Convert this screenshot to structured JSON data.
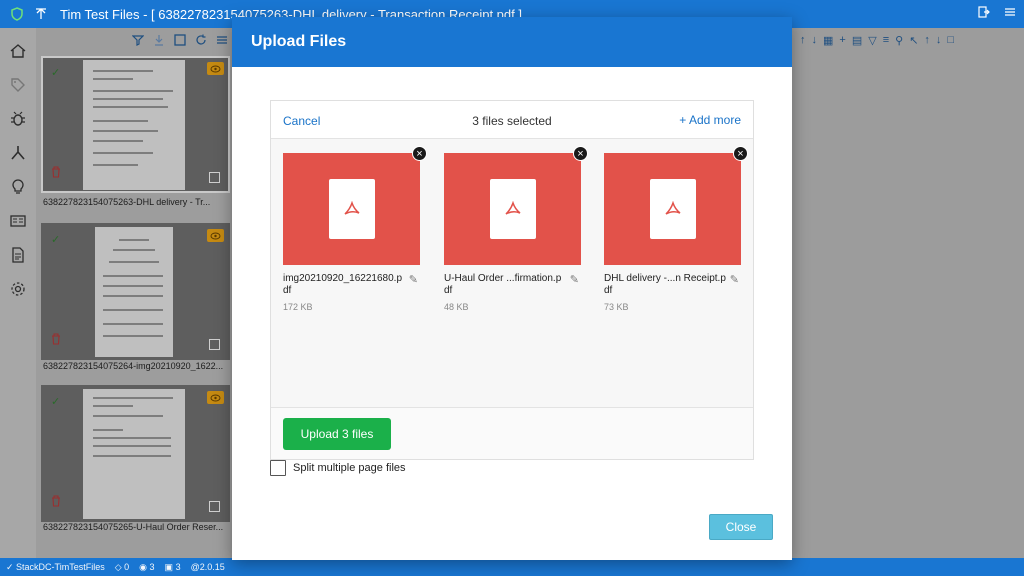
{
  "app": {
    "title": "Tim Test Files - [ 638227823154075263-DHL delivery - Transaction Receipt.pdf ]",
    "logo_icon": "shield-check-icon",
    "up_icon": "arrow-up-icon"
  },
  "sidebar": {
    "items": [
      {
        "name": "home-icon"
      },
      {
        "name": "tag-icon"
      },
      {
        "name": "bug-icon"
      },
      {
        "name": "merge-icon"
      },
      {
        "name": "lightbulb-icon"
      },
      {
        "name": "id-card-icon"
      },
      {
        "name": "document-icon"
      },
      {
        "name": "gear-icon"
      }
    ]
  },
  "gallery": {
    "items": [
      {
        "label": "638227823154075263-DHL delivery - Tr..."
      },
      {
        "label": "638227823154075264-img20210920_1622..."
      },
      {
        "label": "638227823154075265-U-Haul Order Reser..."
      }
    ]
  },
  "modal": {
    "title": "Upload Files",
    "cancel_label": "Cancel",
    "count_label": "3 files selected",
    "add_more_label": "+ Add more",
    "files": [
      {
        "name": "img20210920_16221680.pdf",
        "size": "172 KB"
      },
      {
        "name": "U-Haul Order ...firmation.pdf",
        "size": "48 KB"
      },
      {
        "name": "DHL delivery -...n Receipt.pdf",
        "size": "73 KB"
      }
    ],
    "upload_label": "Upload 3 files",
    "split_label": "Split multiple page files",
    "close_label": "Close"
  },
  "status": {
    "workspace": "StackDC-TimTestFiles",
    "tags": "0",
    "watchers": "3",
    "files": "3",
    "version": "@2.0.15"
  },
  "colors": {
    "primary": "#1976d2",
    "pdf_preview": "#e2524a",
    "upload_button": "#1bb04a",
    "close_button": "#5bc0de"
  }
}
